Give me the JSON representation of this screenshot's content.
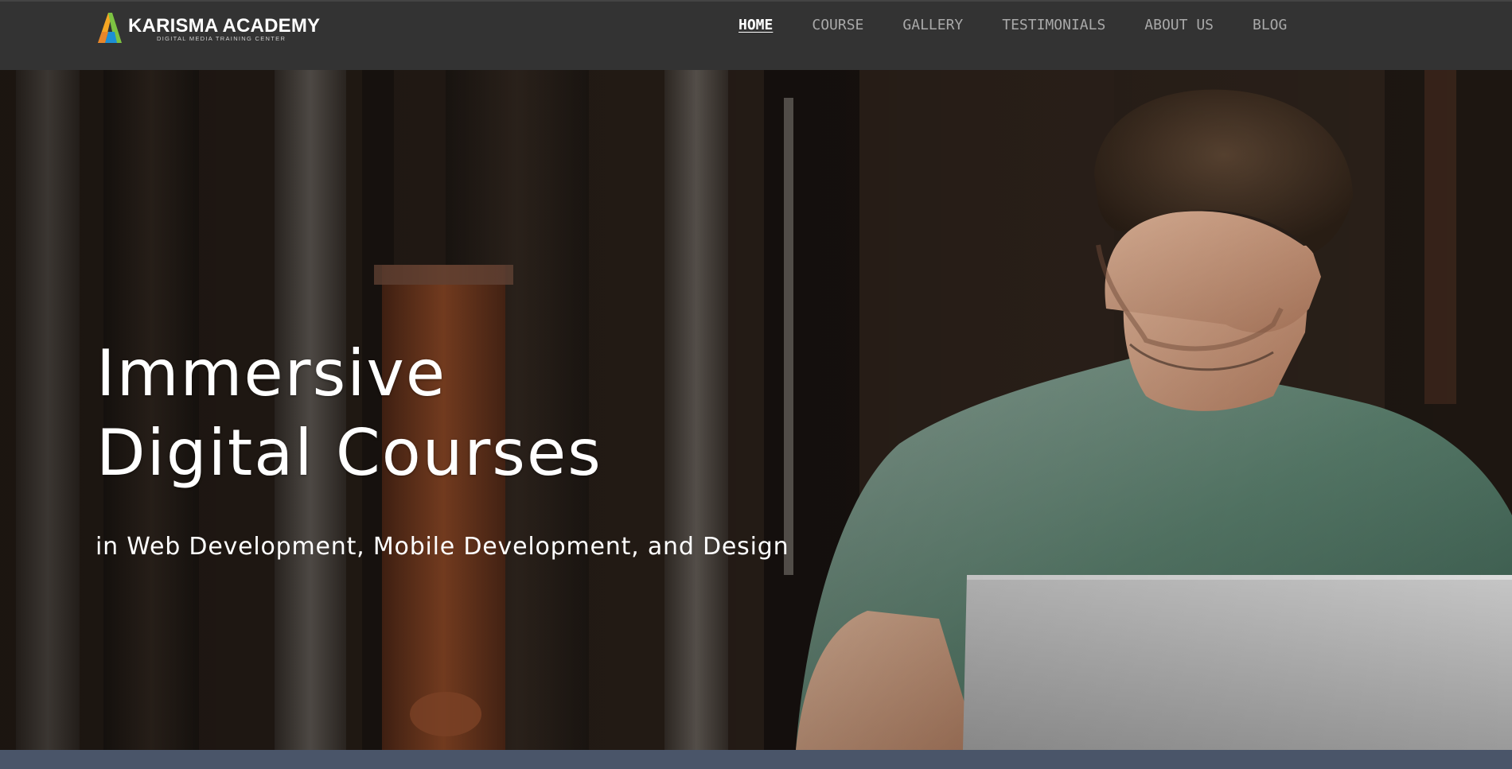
{
  "brand": {
    "name": "KARISMA ACADEMY",
    "tagline": "DIGITAL MEDIA TRAINING CENTER",
    "colors": {
      "logo_orange": "#f5a623",
      "logo_green": "#7cc242",
      "logo_blue": "#1c8fd6"
    }
  },
  "nav": {
    "items": [
      {
        "label": "HOME",
        "active": true
      },
      {
        "label": "COURSE",
        "active": false
      },
      {
        "label": "GALLERY",
        "active": false
      },
      {
        "label": "TESTIMONIALS",
        "active": false
      },
      {
        "label": "ABOUT US",
        "active": false
      },
      {
        "label": "BLOG",
        "active": false
      }
    ]
  },
  "hero": {
    "title_line1": "Immersive",
    "title_line2": "Digital Courses",
    "subtitle": "in Web Development, Mobile Development, and Design",
    "image": "man-with-laptop-photo"
  }
}
